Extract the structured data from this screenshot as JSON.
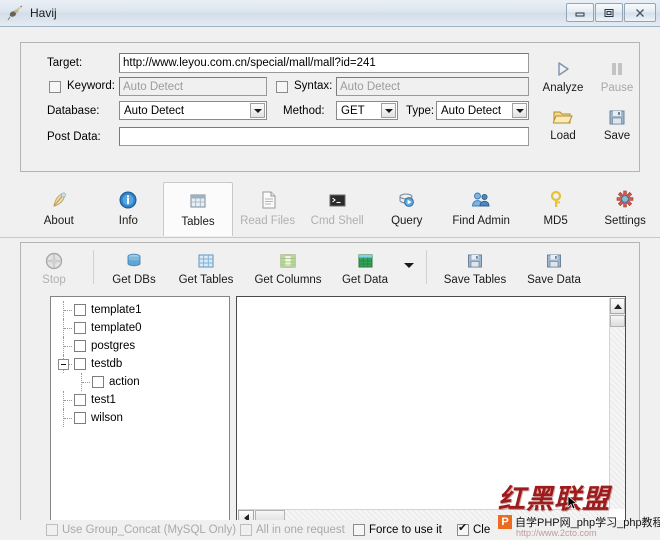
{
  "window": {
    "title": "Havij",
    "app_icon": "bug-icon",
    "buttons": [
      {
        "name": "minimize",
        "glyph": "▬"
      },
      {
        "name": "maximize",
        "glyph": "❐"
      },
      {
        "name": "close",
        "glyph": "✕"
      }
    ]
  },
  "target_form": {
    "target_label": "Target:",
    "target_value": "http://www.leyou.com.cn/special/mall/mall?id=241",
    "keyword_label": "Keyword:",
    "keyword_checked": false,
    "keyword_placeholder": "Auto Detect",
    "syntax_label": "Syntax:",
    "syntax_checked": false,
    "syntax_placeholder": "Auto Detect",
    "database_label": "Database:",
    "database_value": "Auto Detect",
    "method_label": "Method:",
    "method_value": "GET",
    "type_label": "Type:",
    "type_value": "Auto Detect",
    "postdata_label": "Post Data:",
    "postdata_value": ""
  },
  "actions": [
    {
      "label": "Analyze",
      "icon": "play-icon",
      "enabled": true
    },
    {
      "label": "Pause",
      "icon": "pause-icon",
      "enabled": false
    },
    {
      "label": "Load",
      "icon": "folder-open-icon",
      "enabled": true
    },
    {
      "label": "Save",
      "icon": "floppy-disk-icon",
      "enabled": true
    }
  ],
  "tabs": [
    {
      "label": "About",
      "icon": "feather-icon",
      "active": false,
      "enabled": true
    },
    {
      "label": "Info",
      "icon": "info-icon",
      "active": false,
      "enabled": true
    },
    {
      "label": "Tables",
      "icon": "table-icon",
      "active": true,
      "enabled": true
    },
    {
      "label": "Read Files",
      "icon": "document-icon",
      "active": false,
      "enabled": false
    },
    {
      "label": "Cmd Shell",
      "icon": "console-icon",
      "active": false,
      "enabled": false
    },
    {
      "label": "Query",
      "icon": "query-icon",
      "active": false,
      "enabled": true
    },
    {
      "label": "Find Admin",
      "icon": "users-icon",
      "active": false,
      "enabled": true
    },
    {
      "label": "MD5",
      "icon": "key-icon",
      "active": false,
      "enabled": true
    },
    {
      "label": "Settings",
      "icon": "gears-icon",
      "active": false,
      "enabled": true
    }
  ],
  "commands": [
    {
      "label": "Stop",
      "icon": "stop-icon",
      "enabled": false
    },
    {
      "label": "Get DBs",
      "icon": "database-icon",
      "enabled": true
    },
    {
      "label": "Get Tables",
      "icon": "grid-blue-icon",
      "enabled": true
    },
    {
      "label": "Get Columns",
      "icon": "columns-icon",
      "enabled": true
    },
    {
      "label": "Get Data",
      "icon": "data-green-icon",
      "enabled": true
    },
    {
      "label": "Save Tables",
      "icon": "floppy-disk-icon",
      "enabled": true
    },
    {
      "label": "Save Data",
      "icon": "floppy-disk-icon",
      "enabled": true
    }
  ],
  "commands_dropdown_icon": "chevron-down-icon",
  "tree": [
    {
      "label": "template1",
      "indent": 0,
      "checked": false,
      "expander": null
    },
    {
      "label": "template0",
      "indent": 0,
      "checked": false,
      "expander": null
    },
    {
      "label": "postgres",
      "indent": 0,
      "checked": false,
      "expander": null
    },
    {
      "label": "testdb",
      "indent": 0,
      "checked": false,
      "expander": "minus"
    },
    {
      "label": "action",
      "indent": 1,
      "checked": false,
      "expander": null
    },
    {
      "label": "test1",
      "indent": 0,
      "checked": false,
      "expander": null
    },
    {
      "label": "wilson",
      "indent": 0,
      "checked": false,
      "expander": null
    }
  ],
  "grid": {
    "rows": [],
    "vscroll_up_icon": "triangle-up-icon",
    "hscroll_left_icon": "triangle-left-icon"
  },
  "options": [
    {
      "label": "Use Group_Concat (MySQL Only)",
      "checked": false,
      "enabled": false
    },
    {
      "label": "All in one request",
      "checked": false,
      "enabled": false
    },
    {
      "label": "Force to use it",
      "checked": false,
      "enabled": true
    },
    {
      "label": "Cle",
      "checked": true,
      "enabled": true
    }
  ],
  "watermark": {
    "chinese": "红黑联盟",
    "badge": "P",
    "text": "自学PHP网_php学习_php教程",
    "url": "http://www.2cto.com"
  },
  "colors": {
    "window_bg": "#f0f0f0",
    "titlebar": "#dde6ef",
    "field_bg": "#ffffff",
    "disabled_text": "#a9a9a9",
    "watermark_red": "#9e1b1b",
    "badge_orange": "#ee6a1e"
  }
}
